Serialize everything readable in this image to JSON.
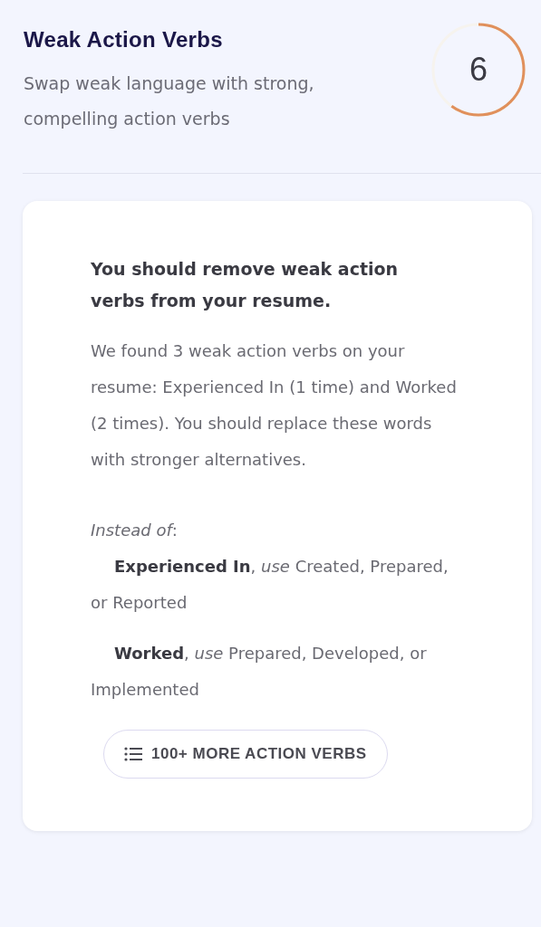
{
  "header": {
    "title": "Weak Action Verbs",
    "subtitle": "Swap weak language with strong, compelling action verbs",
    "score": "6"
  },
  "card": {
    "heading": "You should remove weak action verbs from your resume.",
    "body": "We found 3 weak action verbs on your resume: Experienced In (1 time) and Worked (2 times). You should replace these words with stronger alternatives.",
    "instead_label": "*Instead of*:",
    "suggestions": [
      {
        "text": "**Experienced In**, *use* Created, Prepared, or Reported"
      },
      {
        "text": "**Worked**, *use* Prepared, Developed, or Implemented"
      }
    ],
    "button": "100+ MORE ACTION VERBS"
  }
}
